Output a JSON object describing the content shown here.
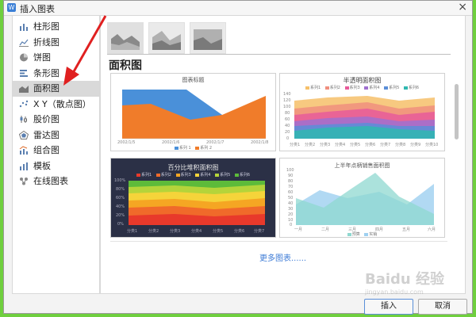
{
  "dialog": {
    "title": "插入图表",
    "close": "×"
  },
  "sidebar": {
    "items": [
      {
        "label": "柱形图",
        "icon": "bar-chart-icon"
      },
      {
        "label": "折线图",
        "icon": "line-chart-icon"
      },
      {
        "label": "饼图",
        "icon": "pie-chart-icon"
      },
      {
        "label": "条形图",
        "icon": "horizontal-bar-icon"
      },
      {
        "label": "面积图",
        "icon": "area-chart-icon",
        "active": true
      },
      {
        "label": "X Y（散点图）",
        "icon": "scatter-icon"
      },
      {
        "label": "股价图",
        "icon": "stock-chart-icon"
      },
      {
        "label": "雷达图",
        "icon": "radar-chart-icon"
      },
      {
        "label": "组合图",
        "icon": "combo-chart-icon"
      },
      {
        "label": "模板",
        "icon": "template-icon"
      },
      {
        "label": "在线图表",
        "icon": "online-chart-icon"
      }
    ]
  },
  "main": {
    "section_title": "面积图",
    "more_link": "更多图表......",
    "cards": [
      {
        "title": "图表标题",
        "xticks": [
          "2002/1/5",
          "2002/1/6",
          "2002/1/7",
          "2002/1/8"
        ],
        "legend": [
          "系列 1",
          "系列 2"
        ],
        "colors": [
          "#4a90d9",
          "#f07c2a"
        ]
      },
      {
        "title": "半透明面积图",
        "yticks": [
          "140",
          "120",
          "100",
          "80",
          "60",
          "40",
          "20",
          "0"
        ],
        "xticks": [
          "分类1",
          "分类2",
          "分类3",
          "分类4",
          "分类5",
          "分类6",
          "分类7",
          "分类8",
          "分类9",
          "分类10"
        ],
        "legend": [
          "系列1",
          "系列2",
          "系列3",
          "系列4",
          "系列5",
          "系列6"
        ],
        "colors": [
          "#f6c06a",
          "#f08f7e",
          "#e85a9a",
          "#a070d0",
          "#5a8ed8",
          "#2fb8b0"
        ]
      },
      {
        "title": "百分比堆积面积图",
        "yticks": [
          "100%",
          "80%",
          "60%",
          "40%",
          "20%",
          "0%"
        ],
        "xticks": [
          "分类1",
          "分类2",
          "分类3",
          "分类4",
          "分类5",
          "分类6",
          "分类7"
        ],
        "legend": [
          "系列1",
          "系列2",
          "系列3",
          "系列4",
          "系列5",
          "系列6"
        ],
        "colors": [
          "#e8392b",
          "#f06a2a",
          "#f5a623",
          "#f5d43a",
          "#b5d43a",
          "#5dbb3a"
        ]
      },
      {
        "title": "上半年点柄销售面积图",
        "yticks": [
          "100",
          "90",
          "80",
          "70",
          "60",
          "50",
          "40",
          "30",
          "20",
          "10",
          "0"
        ],
        "xticks": [
          "一月",
          "二月",
          "三月",
          "四月",
          "五月",
          "六月"
        ],
        "legend": [
          "预算",
          "实销"
        ],
        "colors": [
          "#8fd8d0",
          "#9ed0f0"
        ]
      }
    ]
  },
  "buttons": {
    "insert": "插入",
    "cancel": "取消"
  },
  "watermark": {
    "line1": "Baidu 经验",
    "line2": "jingyan.baidu.com"
  },
  "colors": {
    "accent": "#3d7bd6",
    "annotation_arrow": "#e02020",
    "frame": "#6fcf3e"
  }
}
